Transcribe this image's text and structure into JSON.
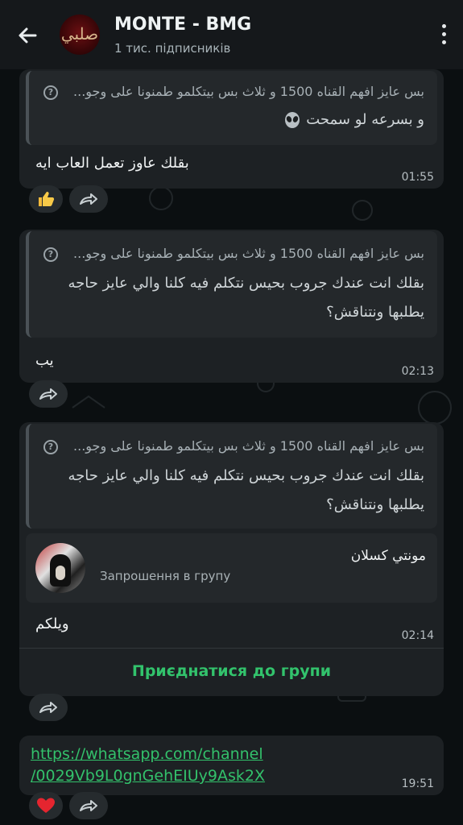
{
  "header": {
    "title": "MONTE - BMG",
    "subtitle": "1 тис. підписників",
    "avatar_text": "صلبي"
  },
  "messages": [
    {
      "quote_line1": "بس عايز افهم القناه 1500 و ثلاث بس بيتكلمو طمنونا على وجو...",
      "quote_line2": "و بسرعه لو سمحت",
      "text": "بقلك عاوز تعمل العاب ايه",
      "time": "01:55",
      "reaction": "thumbs-up"
    },
    {
      "quote_line1": "بس عايز افهم القناه 1500 و ثلاث بس بيتكلمو طمنونا على وجو...",
      "quote_line2": "بقلك انت عندك جروب بحيس نتكلم فيه كلنا والي عايز حاجه",
      "quote_line3": "يطلبها ونتناقش؟",
      "text": "يب",
      "time": "02:13"
    },
    {
      "quote_line1": "بس عايز افهم القناه 1500 و ثلاث بس بيتكلمو طمنونا على وجو...",
      "quote_line2": "بقلك انت عندك جروب بحيس نتكلم فيه كلنا والي عايز حاجه",
      "quote_line3": "يطلبها ونتناقش؟",
      "invite_name": "مونتي كسلان",
      "invite_label": "Запрошення в групу",
      "text": "ويلكم",
      "time": "02:14",
      "join_label": "Приєднатися до групи"
    },
    {
      "link_line1": "https://whatsapp.com/channel",
      "link_line2": "/0029Vb9L0gnGehEIUy9Ask2X",
      "time": "19:51",
      "reaction": "heart"
    }
  ]
}
